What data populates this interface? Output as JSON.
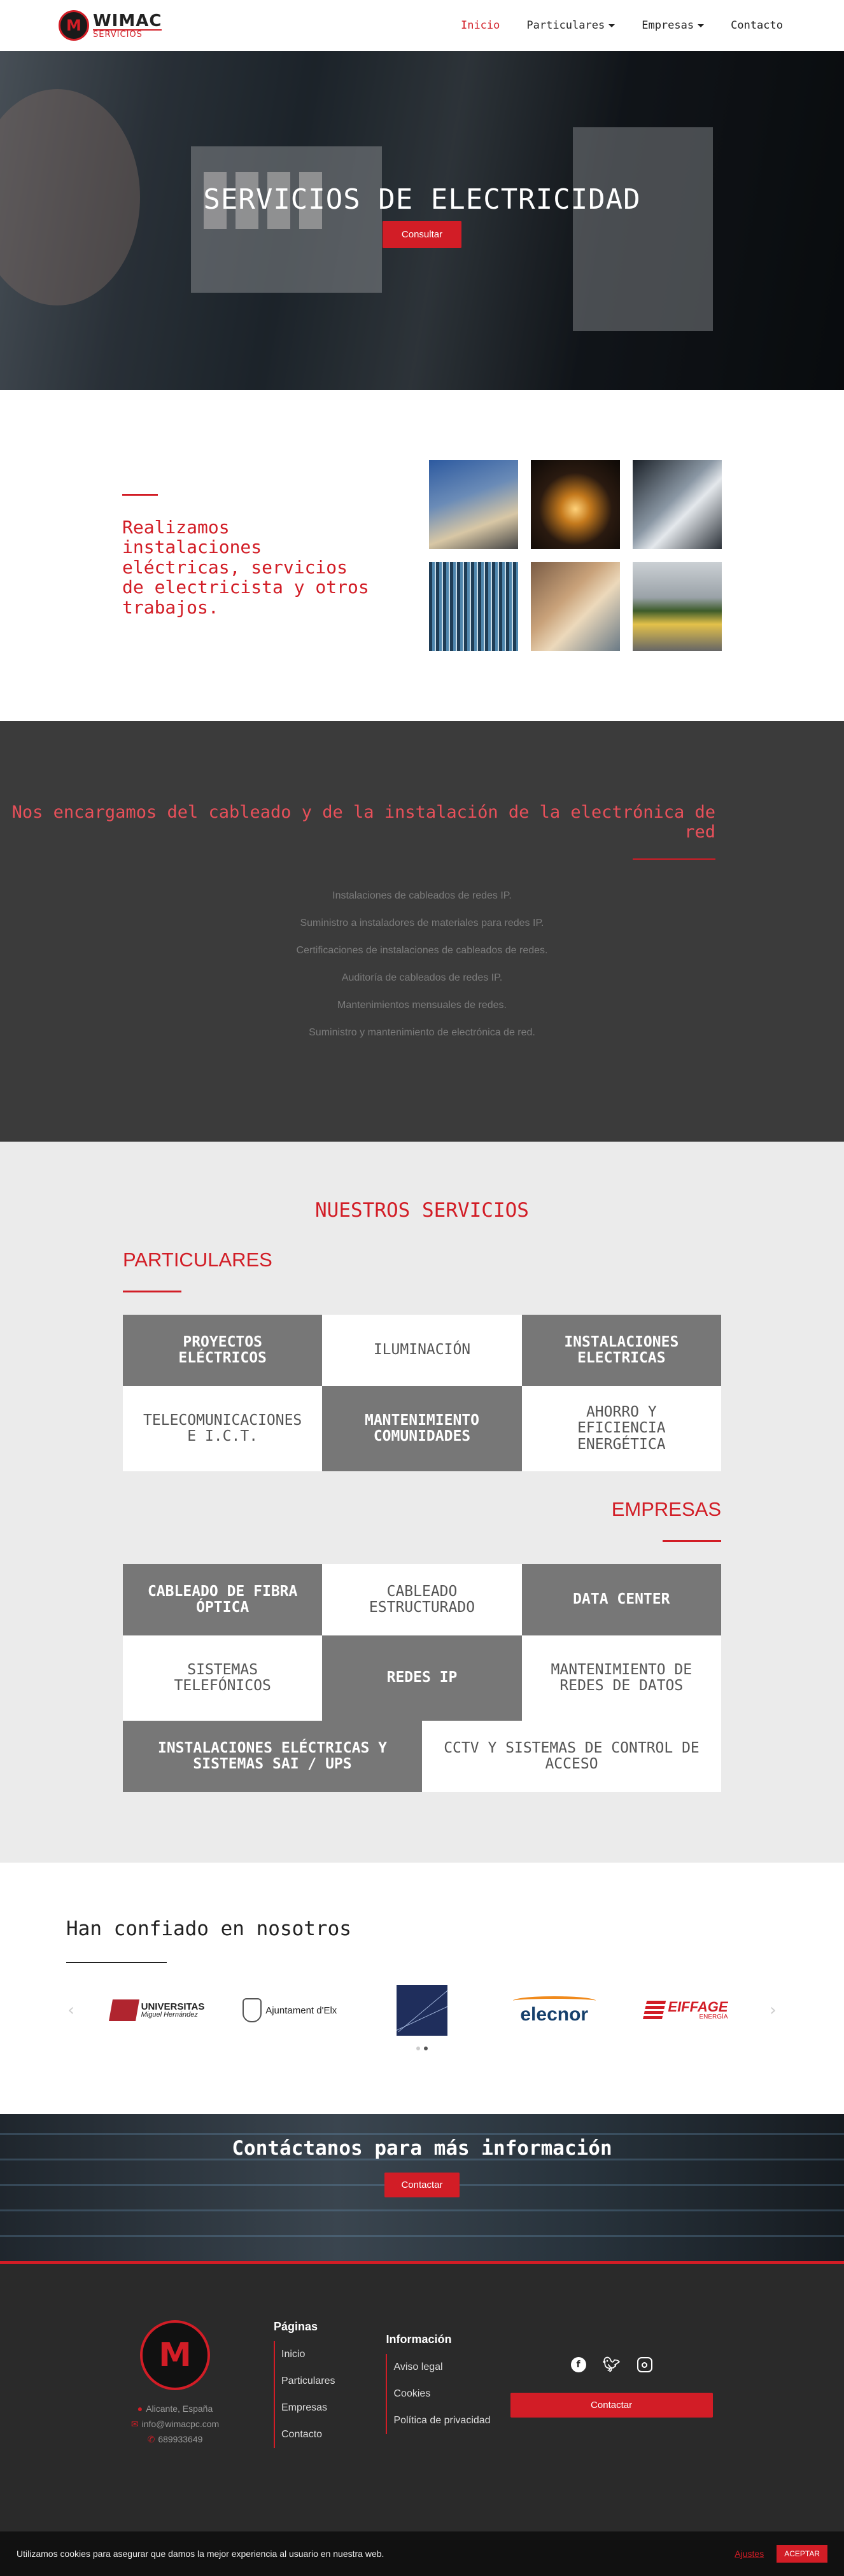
{
  "brand": {
    "name": "WIMAC",
    "sub": "SERVICIOS",
    "mark": "M"
  },
  "nav": {
    "items": [
      {
        "label": "Inicio",
        "dropdown": false
      },
      {
        "label": "Particulares",
        "dropdown": true
      },
      {
        "label": "Empresas",
        "dropdown": true
      },
      {
        "label": "Contacto",
        "dropdown": false
      }
    ]
  },
  "hero": {
    "title": "SERVICIOS DE ELECTRICIDAD",
    "button": "Consultar"
  },
  "intro": {
    "heading": "Realizamos instalaciones eléctricas, servicios de electricista y otros trabajos."
  },
  "network": {
    "heading": "Nos encargamos del cableado y de la instalación de la electrónica de red",
    "items": [
      "Instalaciones de cableados de redes IP.",
      "Suministro a instaladores de materiales para redes IP.",
      "Certificaciones de instalaciones de cableados de redes.",
      "Auditoría de cableados de redes IP.",
      "Mantenimientos mensuales de redes.",
      "Suministro y mantenimiento de electrónica de red."
    ]
  },
  "services": {
    "title": "NUESTROS SERVICIOS",
    "particulares": {
      "heading": "PARTICULARES",
      "tiles": [
        "PROYECTOS ELÉCTRICOS",
        "ILUMINACIÓN",
        "INSTALACIONES ELECTRICAS",
        "TELECOMUNICACIONES E I.C.T.",
        "MANTENIMIENTO COMUNIDADES",
        "AHORRO Y EFICIENCIA ENERGÉTICA"
      ]
    },
    "empresas": {
      "heading": "EMPRESAS",
      "tiles": [
        "CABLEADO DE FIBRA ÓPTICA",
        "CABLEADO ESTRUCTURADO",
        "DATA CENTER",
        "SISTEMAS TELEFÓNICOS",
        "REDES IP",
        "MANTENIMIENTO DE REDES DE DATOS"
      ],
      "wide_tiles": [
        "INSTALACIONES ELÉCTRICAS Y SISTEMAS SAI / UPS",
        "CCTV Y SISTEMAS DE CONTROL DE ACCESO"
      ]
    }
  },
  "clients": {
    "heading": "Han confiado en nosotros",
    "logos": [
      {
        "name": "UNIVERSITAS",
        "sub": "Miguel Hernández",
        "icon": "umh-logo"
      },
      {
        "name": "Ajuntament d'Elx",
        "icon": "elx-logo"
      },
      {
        "name": "",
        "icon": "blue-square-logo"
      },
      {
        "name": "elecnor",
        "icon": "elecnor-logo"
      },
      {
        "name": "EIFFAGE",
        "sub": "ENERGÍA",
        "icon": "eiffage-logo"
      }
    ]
  },
  "cta": {
    "heading": "Contáctanos para más información",
    "button": "Contactar"
  },
  "footer": {
    "contact": {
      "location": "Alicante, España",
      "email": "info@wimacpc.com",
      "phone": "689933649"
    },
    "pages": {
      "heading": "Páginas",
      "links": [
        "Inicio",
        "Particulares",
        "Empresas",
        "Contacto"
      ]
    },
    "info": {
      "heading": "Información",
      "links": [
        "Aviso legal",
        "Cookies",
        "Política de privacidad"
      ]
    },
    "social": [
      "facebook-icon",
      "twitter-icon",
      "instagram-icon"
    ],
    "button": "Contactar"
  },
  "cookie": {
    "text": "Utilizamos cookies para asegurar que damos la mejor experiencia al usuario en nuestra web.",
    "settings": "Ajustes",
    "accept": "ACEPTAR"
  },
  "colors": {
    "accent": "#d21d26",
    "dark": "#3b3b3b",
    "tile": "#777777"
  }
}
